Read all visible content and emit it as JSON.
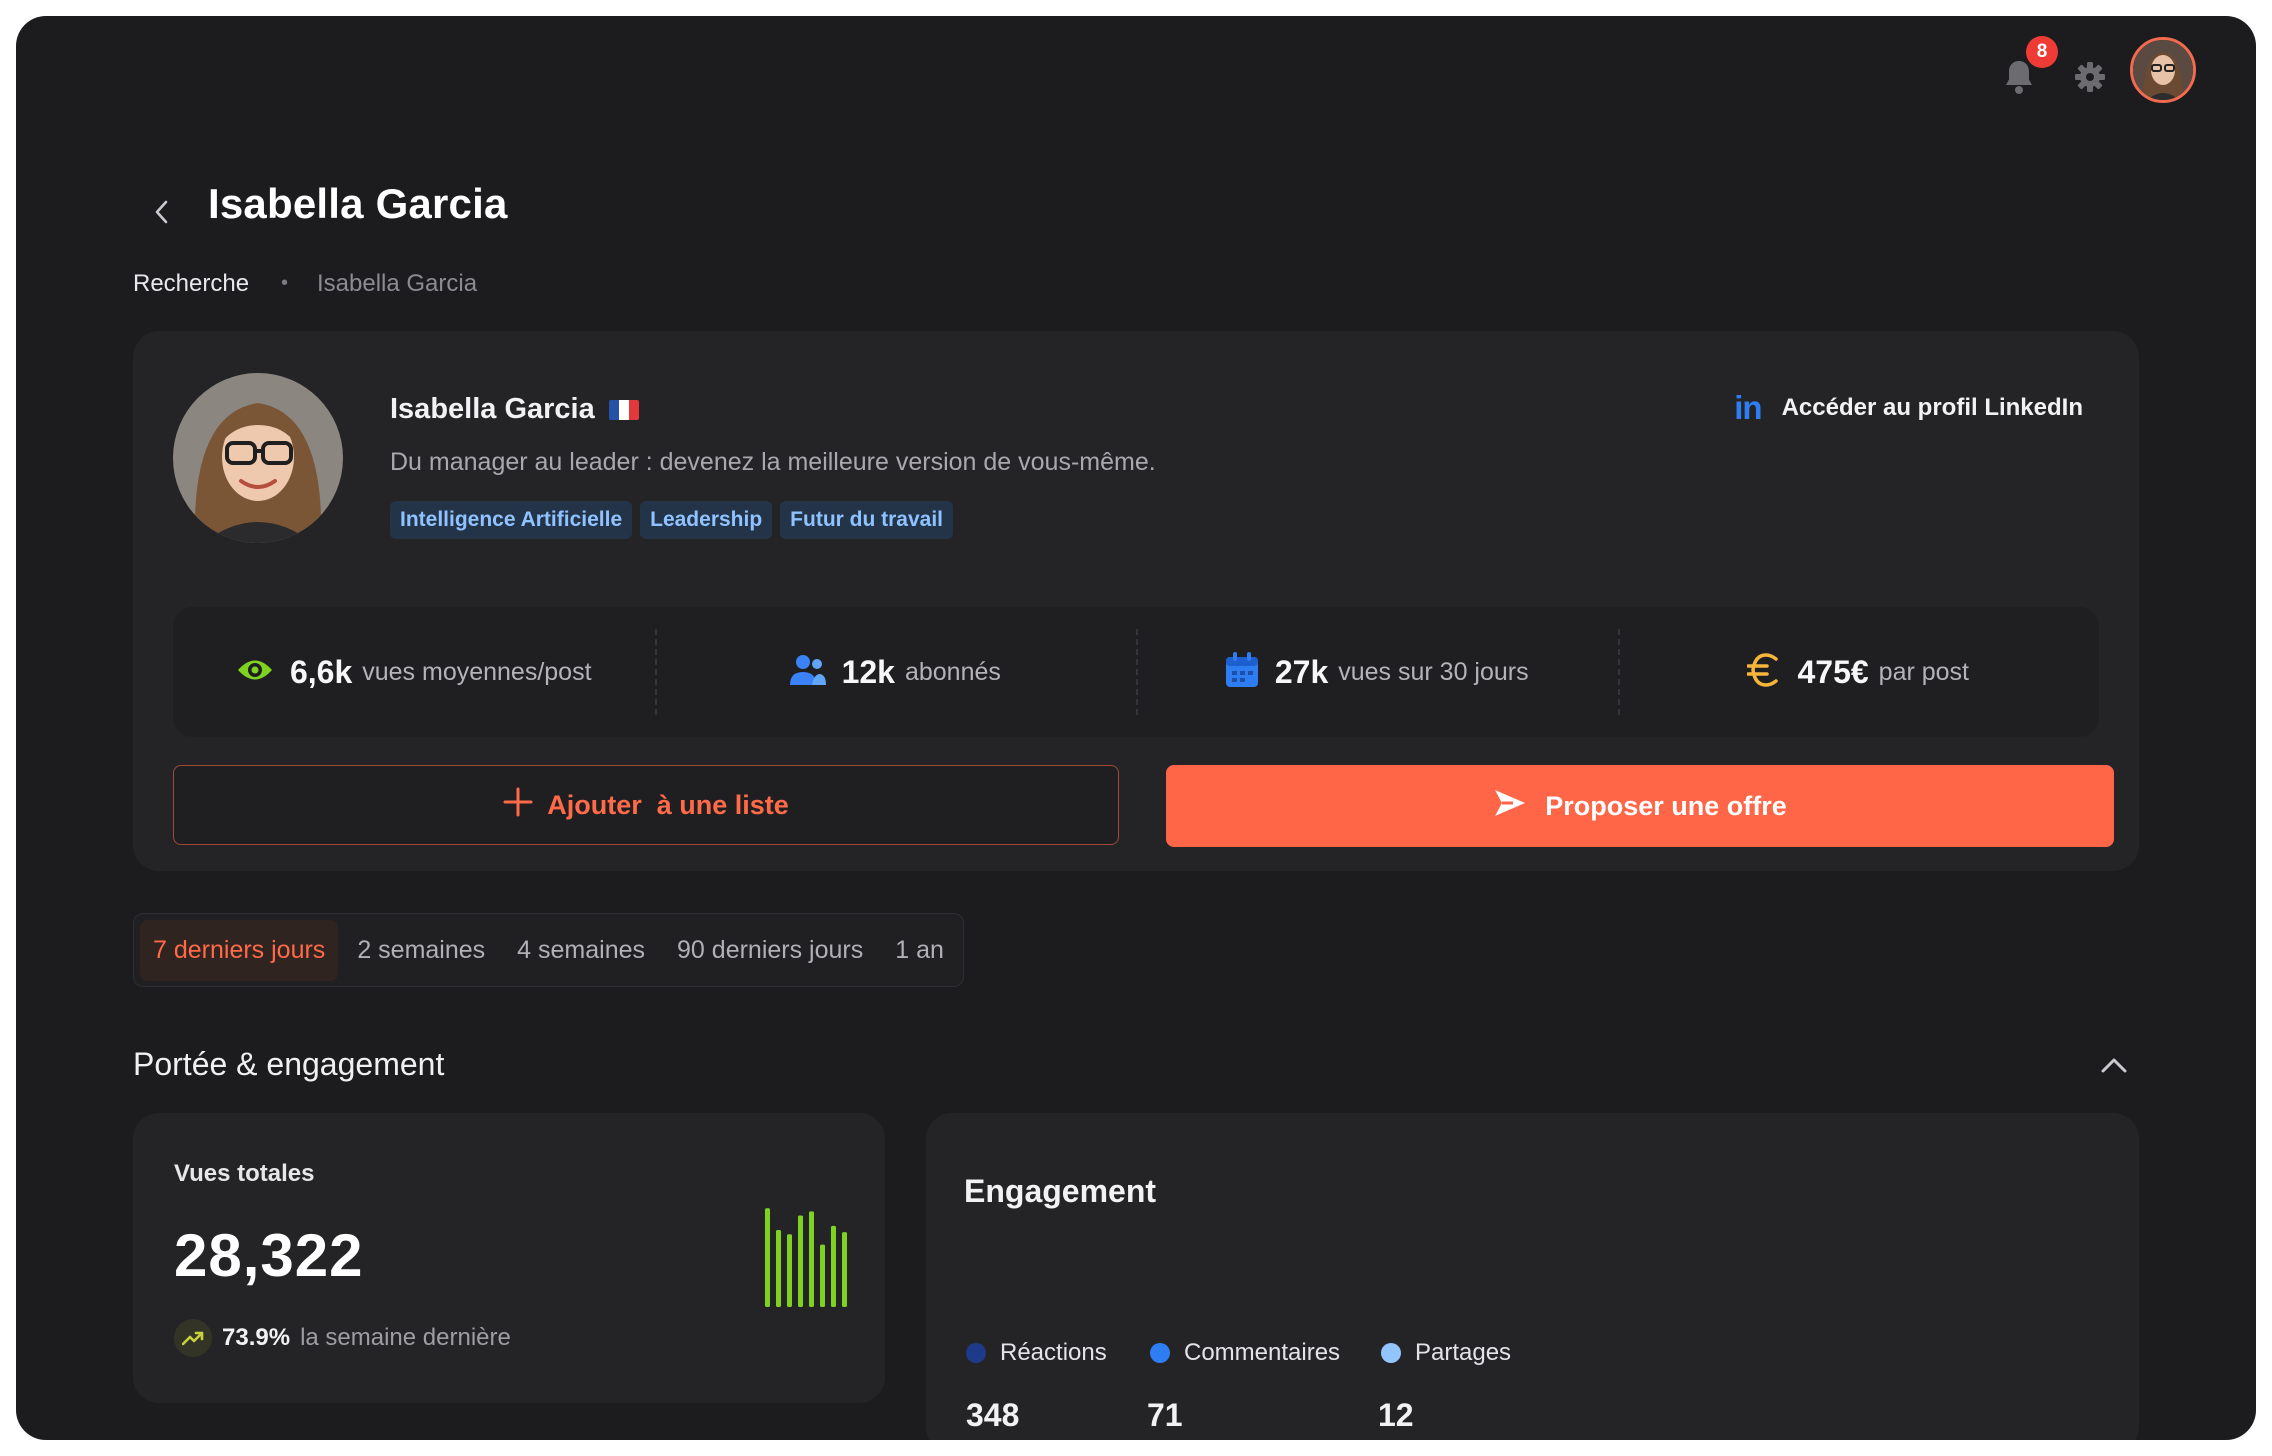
{
  "topbar": {
    "notification_count": "8",
    "icons": [
      "bell-icon",
      "gear-icon"
    ]
  },
  "header": {
    "title": "Isabella Garcia",
    "breadcrumb": [
      "Recherche",
      "•",
      "Isabella Garcia"
    ]
  },
  "profile": {
    "name": "Isabella Garcia",
    "headline": "Du manager au leader : devenez la meilleure version de vous-même.",
    "tags": [
      "Intelligence Artificielle",
      "Leadership",
      "Futur du travail"
    ],
    "linkedin_label": "Accéder au profil LinkedIn",
    "linkedin_logo": "in",
    "stats": [
      {
        "icon": "eye-icon",
        "value": "6,6k",
        "label": "vues moyennes/post",
        "color": "#7ed321"
      },
      {
        "icon": "users-icon",
        "value": "12k",
        "label": "abonnés",
        "color": "#3b82f6"
      },
      {
        "icon": "calendar-icon",
        "value": "27k",
        "label": "vues sur 30 jours",
        "color": "#2f7df2"
      },
      {
        "icon": "euro-icon",
        "value": "475€",
        "label": "par post",
        "color": "#f5b43a"
      }
    ],
    "add_button": "Ajouter  à une liste",
    "offer_button": "Proposer une offre"
  },
  "periods": {
    "tabs": [
      "7 derniers jours",
      "2 semaines",
      "4 semaines",
      "90 derniers jours",
      "1 an"
    ],
    "active": "7 derniers jours"
  },
  "section": {
    "title": "Portée & engagement"
  },
  "views_card": {
    "title": "Vues totales",
    "value": "28,322",
    "trend_pct": "73.9%",
    "trend_text": "la semaine dernière",
    "sparkline": [
      0.95,
      0.74,
      0.7,
      0.88,
      0.92,
      0.6,
      0.78,
      0.72
    ],
    "spark_color": "#7ed321"
  },
  "engagement": {
    "title": "Engagement",
    "legend": [
      {
        "label": "Réactions",
        "color": "#1e3a8a",
        "value": "348"
      },
      {
        "label": "Commentaires",
        "color": "#2f7df2",
        "value": "71"
      },
      {
        "label": "Partages",
        "color": "#93c5fd",
        "value": "12"
      }
    ]
  },
  "colors": {
    "accent": "#ff6648",
    "background": "#1c1c1f",
    "card": "#242427"
  }
}
